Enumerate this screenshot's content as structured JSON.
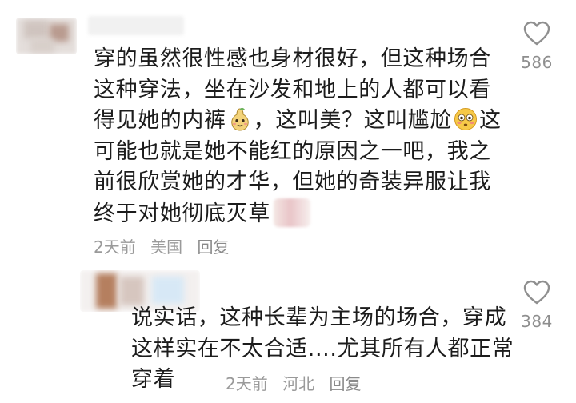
{
  "comments": [
    {
      "text_before_emoji1": "穿的虽然很性感也身材很好，但这种场合这种穿法，坐在沙发和地上的人都可以看得见她的内裤",
      "text_mid": "，这叫美？这叫尴尬",
      "text_after_emoji2": "这可能也就是她不能红的原因之一吧，我之前很欣赏她的才华，但她的奇装异服让我终于对她彻底灭草",
      "emoji1": "pear-face-emoji",
      "emoji2": "flushed-face-emoji",
      "time": "2天前",
      "location": "美国",
      "reply_label": "回复",
      "likes": "586"
    },
    {
      "text": "说实话，这种长辈为主场的场合，穿成这样实在不太合适....尤其所有人都正常穿着",
      "time": "2天前",
      "location": "河北",
      "reply_label": "回复",
      "likes": "384"
    }
  ],
  "icons": {
    "like": "heart-outline-icon"
  }
}
